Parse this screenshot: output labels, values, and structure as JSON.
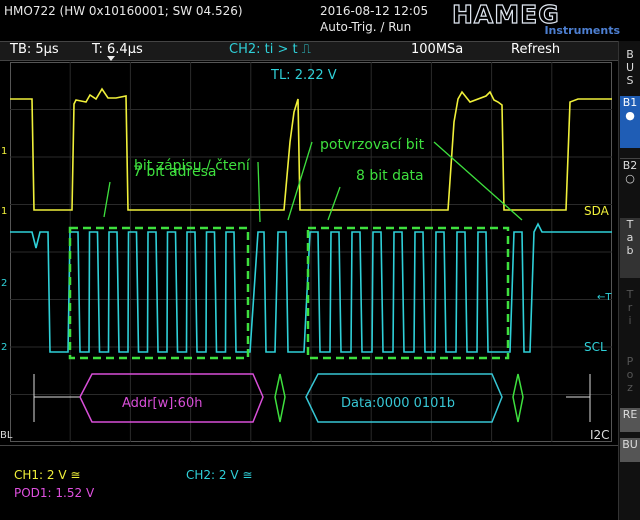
{
  "header": {
    "model": "HMO722 (HW 0x10160001; SW 04.526)",
    "datetime": "2016-08-12 12:05",
    "status": "Auto-Trig. / Run",
    "logo": "HAMEG",
    "logo_sub": "Instruments"
  },
  "topbar": {
    "timebase": "TB: 5µs",
    "trigger_time": "T: 6.4µs",
    "trigger_cond": "CH2: ti > t ⎍",
    "sample_rate": "100MSa",
    "mode": "Refresh"
  },
  "plot": {
    "trigger_level": "TL: 2.22 V",
    "annotations": {
      "ack_bit": "potvrzovací bit",
      "rw_bit": "bit zápisu / čtení",
      "addr_bits": "7 bit adresa",
      "data_bits": "8 bit data"
    },
    "trace_labels": {
      "sda": "SDA",
      "scl": "SCL",
      "bus": "I2C"
    },
    "decode": {
      "address": "Addr[w]:60h",
      "data": "Data:0000 0101b"
    },
    "left_markers": {
      "ch1a": "1",
      "ch1b": "1",
      "ch2a": "2",
      "ch2b": "2",
      "bus": "BL"
    },
    "right_marker": "←T"
  },
  "sidebar": {
    "bus_label": "BUS",
    "b1": "B1",
    "b2": "B2",
    "tab": "Tab",
    "tri": "Tri",
    "poz": "Poz",
    "re": "RE",
    "bu": "BU"
  },
  "footer": {
    "ch1": "CH1: 2 V ≅",
    "ch2": "CH2: 2 V ≅",
    "pod1": "POD1: 1.52 V"
  },
  "colors": {
    "ch1": "#f0f03a",
    "ch2": "#2fd0d8",
    "pod": "#e050e0",
    "annotation": "#3ee03e",
    "bus_addr": "#d84fd8",
    "bus_data": "#37c6d4"
  }
}
